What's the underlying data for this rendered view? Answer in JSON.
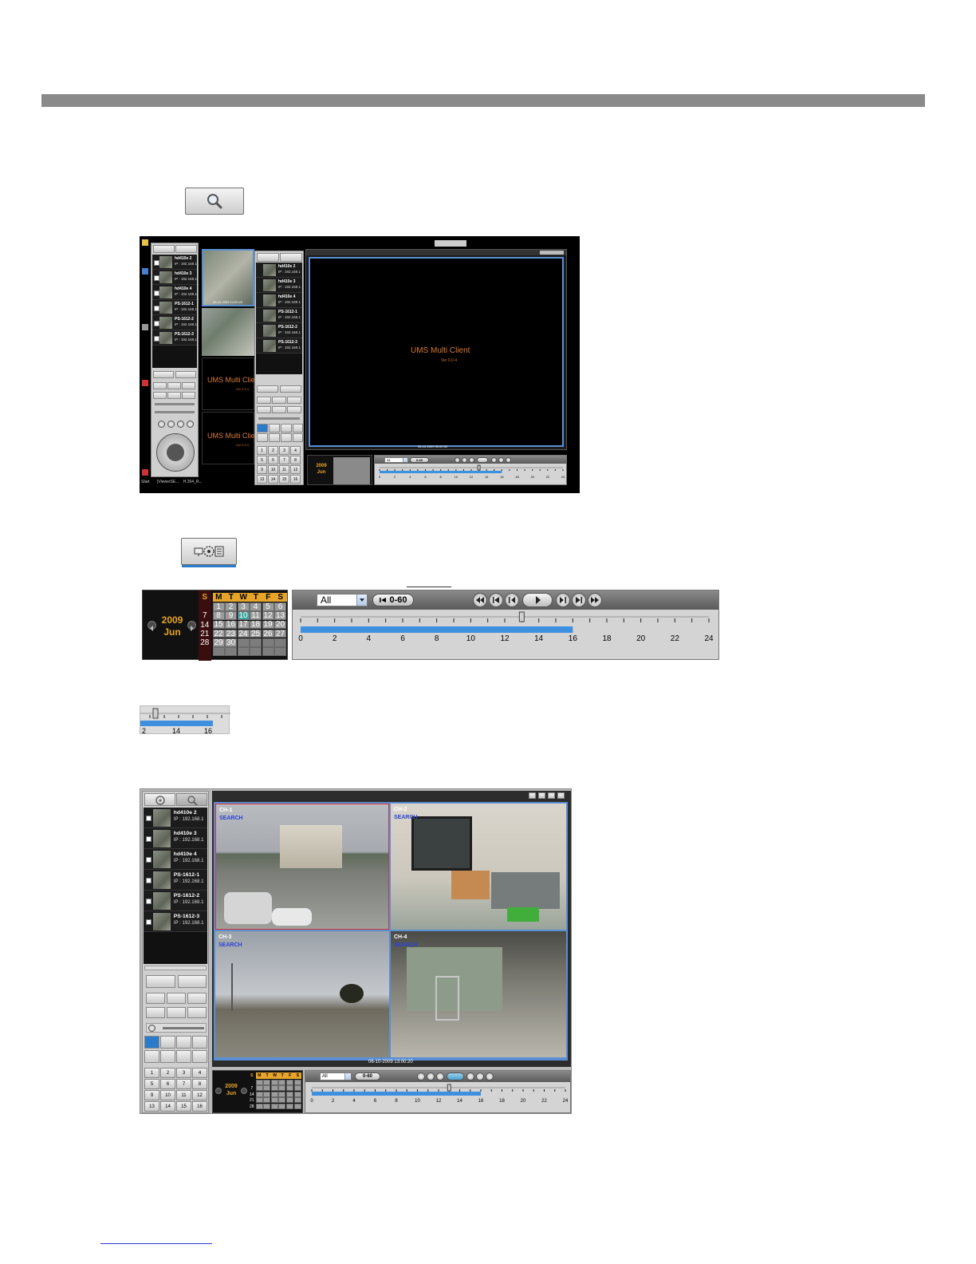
{
  "toolbar_icons": {
    "search_button_icon": "magnifier-icon",
    "backup_button_icon": "backup-icon"
  },
  "screenshot1": {
    "taskbar_items": [
      "Start",
      "[ViewerSE...",
      "H.264_R..."
    ],
    "camera_list": [
      {
        "name": "hd410e 2",
        "ip": "IP : 192.168.1",
        "checked": true
      },
      {
        "name": "hd410e 3",
        "ip": "IP : 192.168.1",
        "checked": true
      },
      {
        "name": "hd410e 4",
        "ip": "IP : 192.168.1",
        "checked": true
      },
      {
        "name": "PS-1612-1",
        "ip": "IP : 192.168.1",
        "checked": true
      },
      {
        "name": "PS-1612-2",
        "ip": "IP : 192.168.1",
        "checked": true
      },
      {
        "name": "PS-1612-3",
        "ip": "IP : 192.168.1",
        "checked": true
      }
    ],
    "camera_list_right": [
      {
        "name": "hd410e 2",
        "ip": "IP : 192.168.1"
      },
      {
        "name": "hd410e 3",
        "ip": "IP : 192.168.1"
      },
      {
        "name": "hd410e 4",
        "ip": "IP : 192.168.1"
      },
      {
        "name": "PS-1612-1",
        "ip": "IP : 192.168.1"
      },
      {
        "name": "PS-1612-2",
        "ip": "IP : 192.168.1"
      },
      {
        "name": "PS-1612-3",
        "ip": "IP : 192.168.1"
      }
    ],
    "ums_title": "UMS Multi Client",
    "ums_title_partial": "UMS Multi Clie",
    "version": "Ver 0.0.4",
    "version_partial": "Ver 0.0.4",
    "thumb_timestamp": "06-10-2009 14:00:20",
    "main_timestamp": "06-10-2009 00:00:00",
    "channel_numbers": [
      "1",
      "2",
      "3",
      "4",
      "5",
      "6",
      "7",
      "8",
      "9",
      "10",
      "11",
      "12",
      "13",
      "14",
      "15",
      "16"
    ],
    "calendar_year": "2009",
    "calendar_month": "Jun",
    "timeline_filter": "All",
    "timeline_goto": "0-60",
    "timeline_labels": [
      "0",
      "2",
      "4",
      "6",
      "8",
      "10",
      "12",
      "14",
      "16",
      "18",
      "20",
      "22",
      "24"
    ]
  },
  "calendar": {
    "year": "2009",
    "month": "Jun",
    "weekdays": [
      "S",
      "M",
      "T",
      "W",
      "T",
      "F",
      "S"
    ],
    "weeks": [
      [
        "",
        "1",
        "2",
        "3",
        "4",
        "5",
        "6"
      ],
      [
        "7",
        "8",
        "9",
        "10",
        "11",
        "12",
        "13"
      ],
      [
        "14",
        "15",
        "16",
        "17",
        "18",
        "19",
        "20"
      ],
      [
        "21",
        "22",
        "23",
        "24",
        "25",
        "26",
        "27"
      ],
      [
        "28",
        "29",
        "30",
        "",
        "",
        "",
        ""
      ],
      [
        "",
        "",
        "",
        "",
        "",
        "",
        ""
      ]
    ],
    "highlighted_day": "10"
  },
  "timeline": {
    "filter_value": "All",
    "goto_label": "0-60",
    "hour_labels": [
      "0",
      "2",
      "4",
      "6",
      "8",
      "10",
      "12",
      "14",
      "16",
      "18",
      "20",
      "22",
      "24"
    ],
    "recorded_until_hour": 16,
    "cursor_hour": 13
  },
  "timeline_zoom": {
    "labels": [
      "2",
      "14",
      "16"
    ]
  },
  "screenshot2": {
    "channels": [
      {
        "label": "CH-1",
        "status": "SEARCH",
        "label_color": "#d62020"
      },
      {
        "label": "CH-2",
        "status": "SEARCH",
        "label_color": "#ffffff"
      },
      {
        "label": "CH-3",
        "status": "SEARCH",
        "label_color": "#ffffff"
      },
      {
        "label": "CH-4",
        "status": "SEARCH",
        "label_color": "#ffffff"
      }
    ],
    "timestamp": "06-10-2009 13:00:20",
    "camera_list": [
      {
        "name": "hd410e 2",
        "ip": "IP : 192.168.1",
        "checked": true
      },
      {
        "name": "hd410e 3",
        "ip": "IP : 192.168.1",
        "checked": false
      },
      {
        "name": "hd410e 4",
        "ip": "IP : 192.168.1",
        "checked": false
      },
      {
        "name": "PS-1612-1",
        "ip": "IP : 192.168.1",
        "checked": false
      },
      {
        "name": "PS-1612-2",
        "ip": "IP : 192.168.1",
        "checked": false
      },
      {
        "name": "PS-1612-3",
        "ip": "IP : 192.168.1",
        "checked": false
      }
    ],
    "channel_numbers": [
      "1",
      "2",
      "3",
      "4",
      "5",
      "6",
      "7",
      "8",
      "9",
      "10",
      "11",
      "12",
      "13",
      "14",
      "15",
      "16"
    ],
    "calendar_year": "2009",
    "calendar_month": "Jun",
    "calendar_weekdays": [
      "S",
      "M",
      "T",
      "W",
      "T",
      "F",
      "S"
    ],
    "calendar_days": [
      "7",
      "14",
      "21",
      "28"
    ],
    "timeline_filter": "All",
    "timeline_goto": "0-60",
    "timeline_labels": [
      "0",
      "2",
      "4",
      "6",
      "8",
      "10",
      "12",
      "14",
      "16",
      "18",
      "20",
      "22",
      "24"
    ]
  },
  "colors": {
    "header_rule": "#8a8a8a",
    "recorded_bar": "#3d8fdf",
    "calendar_accent": "#e6a42a",
    "ums_text": "#d97a36",
    "search_text": "#2c42d6"
  }
}
